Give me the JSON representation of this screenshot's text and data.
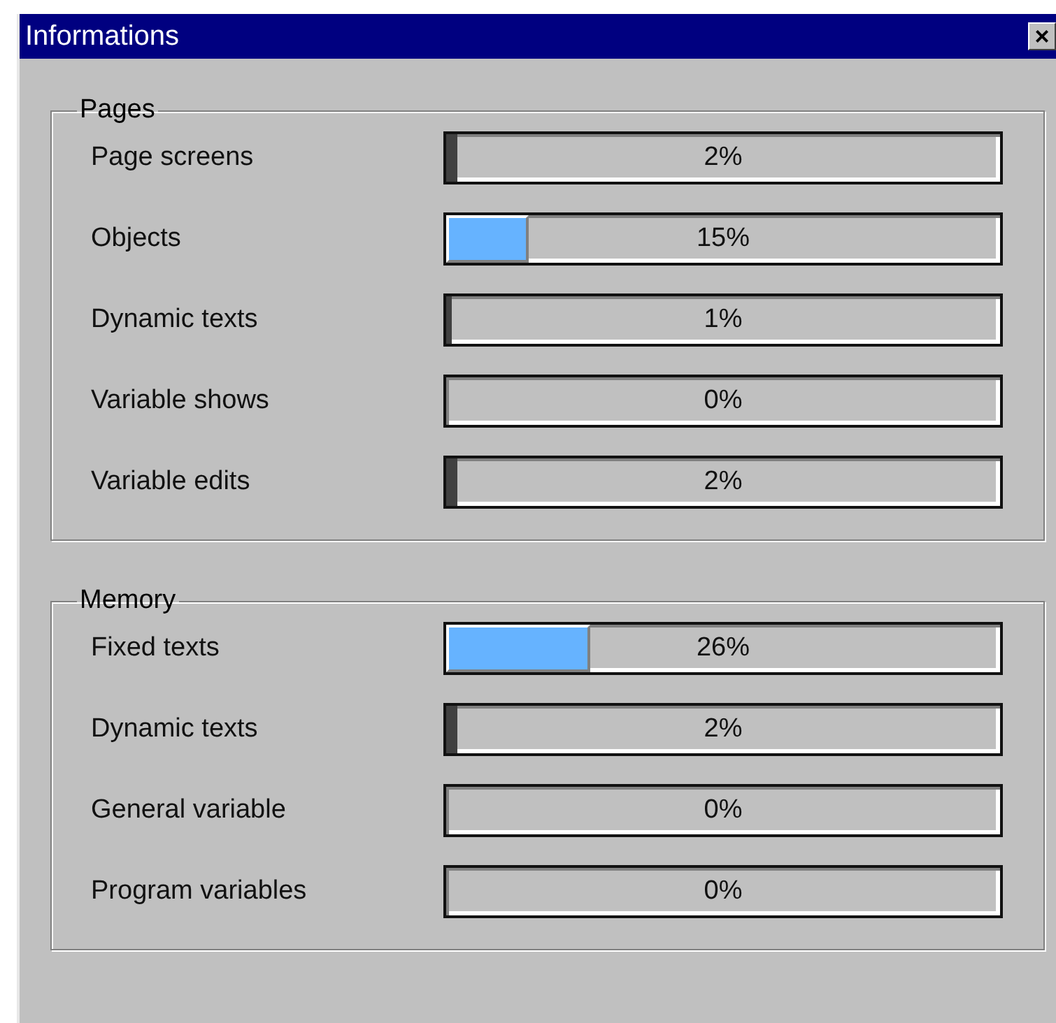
{
  "window": {
    "title": "Informations",
    "close": "×"
  },
  "groups": [
    {
      "title": "Pages",
      "rows": [
        {
          "label": "Page screens",
          "level": 0.02,
          "reading": "2%"
        },
        {
          "label": "Objects",
          "level": 0.15,
          "reading": "15%"
        },
        {
          "label": "Dynamic texts",
          "level": 0.01,
          "reading": "1%"
        },
        {
          "label": "Variable shows",
          "level": 0,
          "reading": "0%"
        },
        {
          "label": "Variable edits",
          "level": 0.02,
          "reading": "2%"
        }
      ]
    },
    {
      "title": "Memory",
      "rows": [
        {
          "label": "Fixed texts",
          "level": 0.26,
          "reading": "26%"
        },
        {
          "label": "Dynamic texts",
          "level": 0.02,
          "reading": "2%"
        },
        {
          "label": "General variable",
          "level": 0,
          "reading": "0%"
        },
        {
          "label": "Program variables",
          "level": 0,
          "reading": "0%"
        }
      ]
    }
  ]
}
